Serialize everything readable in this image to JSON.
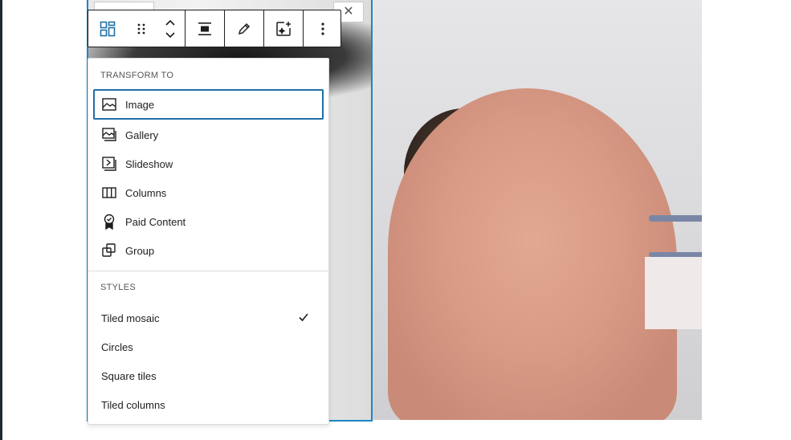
{
  "toolbar": {
    "buttons": [
      "gallery-transform",
      "drag-handle",
      "move-up-down",
      "align",
      "edit",
      "add-media",
      "more-options"
    ]
  },
  "menu": {
    "transform_title": "Transform to",
    "transform_items": [
      {
        "label": "Image",
        "icon": "image-icon"
      },
      {
        "label": "Gallery",
        "icon": "gallery-icon"
      },
      {
        "label": "Slideshow",
        "icon": "slideshow-icon"
      },
      {
        "label": "Columns",
        "icon": "columns-icon"
      },
      {
        "label": "Paid Content",
        "icon": "badge-icon"
      },
      {
        "label": "Group",
        "icon": "group-icon"
      }
    ],
    "styles_title": "Styles",
    "style_items": [
      {
        "label": "Tiled mosaic",
        "selected": true
      },
      {
        "label": "Circles",
        "selected": false
      },
      {
        "label": "Square tiles",
        "selected": false
      },
      {
        "label": "Tiled columns",
        "selected": false
      }
    ]
  },
  "close_label": "✕",
  "colors": {
    "accent": "#1d86c6",
    "focus": "#1f6fa6",
    "text": "#1e1e1e"
  }
}
